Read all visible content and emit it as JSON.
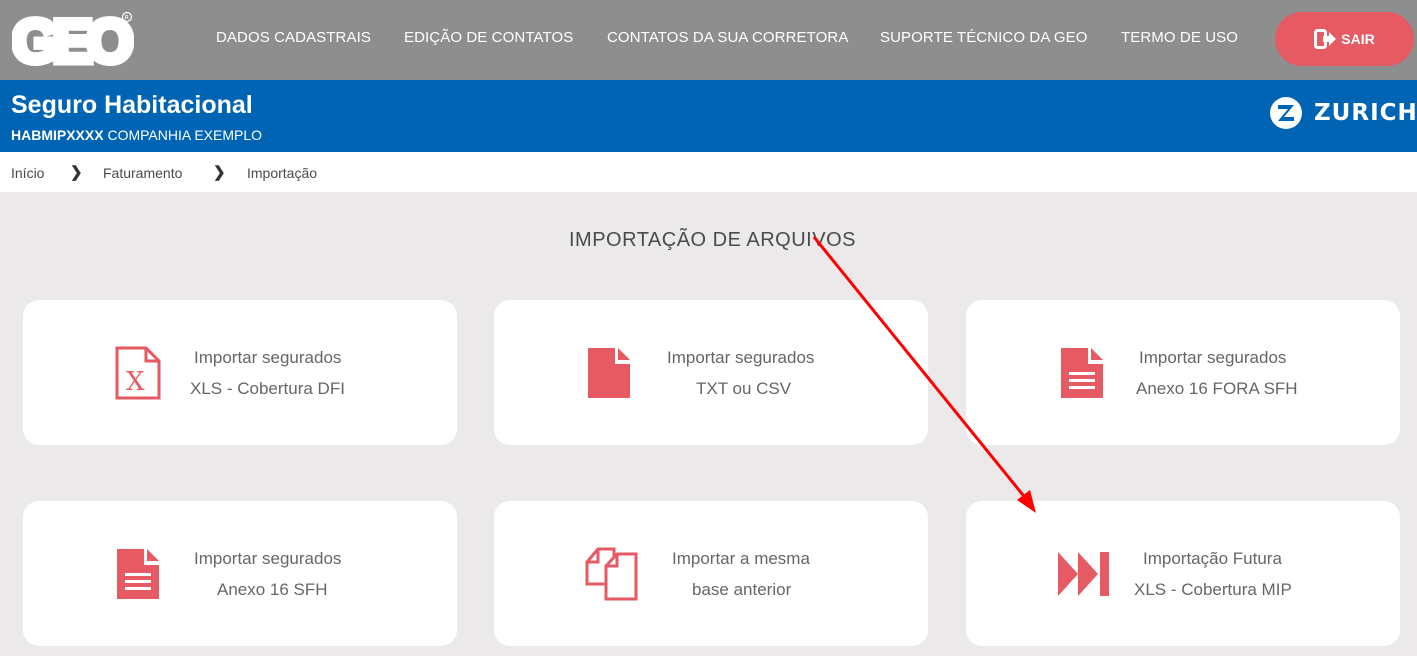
{
  "header": {
    "logo_text": "GEO",
    "nav": [
      "DADOS CADASTRAIS",
      "EDIÇÃO DE CONTATOS",
      "CONTATOS DA SUA CORRETORA",
      "SUPORTE TÉCNICO DA GEO",
      "TERMO DE USO"
    ],
    "logout_label": "SAIR"
  },
  "banner": {
    "title": "Seguro Habitacional",
    "code": "HABMIPXXXX",
    "company": "COMPANHIA EXEMPLO",
    "brand": "ZURICH"
  },
  "breadcrumb": [
    "Início",
    "Faturamento",
    "Importação"
  ],
  "page_title": "IMPORTAÇÃO DE ARQUIVOS",
  "cards": [
    {
      "line1": "Importar segurados",
      "line2": "XLS - Cobertura DFI",
      "icon": "excel-file-icon"
    },
    {
      "line1": "Importar segurados",
      "line2": "TXT ou CSV",
      "icon": "file-icon"
    },
    {
      "line1": "Importar segurados",
      "line2": "Anexo 16 FORA SFH",
      "icon": "document-icon"
    },
    {
      "line1": "Importar segurados",
      "line2": "Anexo 16 SFH",
      "icon": "document-icon"
    },
    {
      "line1": "Importar a mesma",
      "line2": "base anterior",
      "icon": "copy-icon"
    },
    {
      "line1": "Importação Futura",
      "line2": "XLS - Cobertura MIP",
      "icon": "fast-forward-icon"
    }
  ],
  "colors": {
    "accent": "#e65a63",
    "header_blue": "#0064b4",
    "topbar_gray": "#8e8e8e",
    "arrow": "#ff0000"
  }
}
